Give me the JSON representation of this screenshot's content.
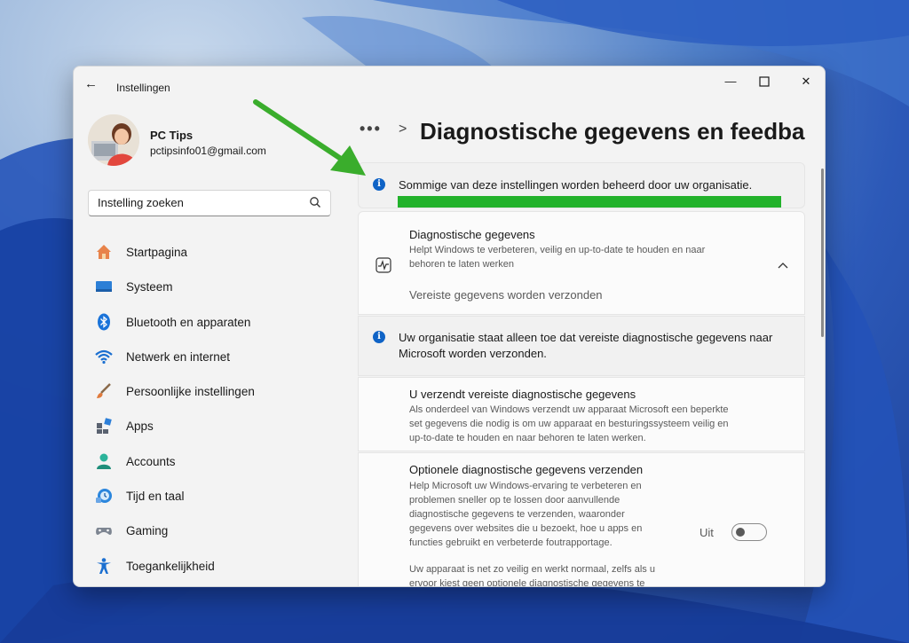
{
  "window": {
    "title": "Instellingen"
  },
  "profile": {
    "name": "PC Tips",
    "email": "pctipsinfo01@gmail.com"
  },
  "search": {
    "placeholder": "Instelling zoeken"
  },
  "nav": [
    {
      "label": "Startpagina",
      "icon": "home-icon"
    },
    {
      "label": "Systeem",
      "icon": "system-icon"
    },
    {
      "label": "Bluetooth en apparaten",
      "icon": "bluetooth-icon"
    },
    {
      "label": "Netwerk en internet",
      "icon": "wifi-icon"
    },
    {
      "label": "Persoonlijke instellingen",
      "icon": "brush-icon"
    },
    {
      "label": "Apps",
      "icon": "apps-icon"
    },
    {
      "label": "Accounts",
      "icon": "accounts-icon"
    },
    {
      "label": "Tijd en taal",
      "icon": "time-language-icon"
    },
    {
      "label": "Gaming",
      "icon": "gamepad-icon"
    },
    {
      "label": "Toegankelijkheid",
      "icon": "accessibility-icon"
    }
  ],
  "breadcrumb": {
    "more": "•••",
    "separator": ">",
    "title": "Diagnostische gegevens en feedba"
  },
  "banner": {
    "text": "Sommige van deze instellingen worden beheerd door uw organisatie."
  },
  "diagnostics": {
    "title": "Diagnostische gegevens",
    "desc1": "Helpt Windows te verbeteren, veilig en up-to-date te houden en naar",
    "desc2": "behoren te laten werken",
    "status": "Vereiste gegevens worden verzonden"
  },
  "org_notice": {
    "line1": "Uw organisatie staat alleen toe dat vereiste diagnostische gegevens naar",
    "line2": "Microsoft worden verzonden."
  },
  "required": {
    "title": "U verzendt vereiste diagnostische gegevens",
    "lines": [
      "Als onderdeel van Windows verzendt uw apparaat Microsoft een beperkte",
      "set gegevens die nodig is om uw apparaat en besturingssysteem veilig en",
      "up-to-date te houden en naar behoren te laten werken."
    ]
  },
  "optional": {
    "title": "Optionele diagnostische gegevens verzenden",
    "lines": [
      "Help Microsoft uw Windows-ervaring te verbeteren en",
      "problemen sneller op te lossen door aanvullende",
      "diagnostische gegevens te verzenden, waaronder",
      "gegevens over websites die u bezoekt, hoe u apps en",
      "functies gebruikt en verbeterde foutrapportage."
    ],
    "lines2": [
      "Uw apparaat is net zo veilig en werkt normaal, zelfs als u",
      "ervoor kiest geen optionele diagnostische gegevens te"
    ],
    "toggle_label": "Uit",
    "toggle_on": false
  },
  "colors": {
    "accent": "#0f63c6",
    "highlight": "#22b22b",
    "arrow": "#3aad2c"
  }
}
